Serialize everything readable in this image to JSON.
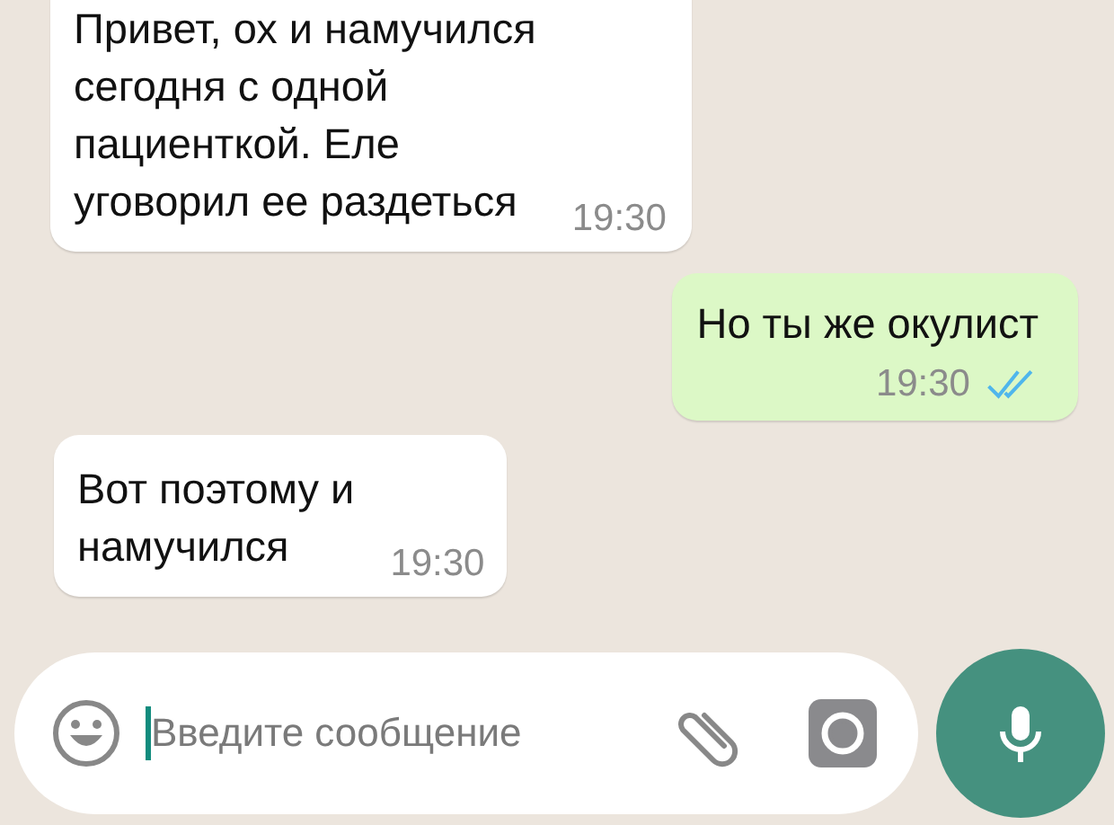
{
  "messages": [
    {
      "kind": "incoming",
      "text": "Привет, ох и намучился\nсегодня с одной\nпациенткой. Еле\nуговорил ее раздеться",
      "time": "19:30",
      "read": false
    },
    {
      "kind": "outgoing",
      "text": "Но ты же окулист",
      "time": "19:30",
      "read": true
    },
    {
      "kind": "incoming",
      "text": "Вот поэтому и\nнамучился",
      "time": "19:30",
      "read": false
    }
  ],
  "composer": {
    "placeholder": "Введите сообщение"
  }
}
